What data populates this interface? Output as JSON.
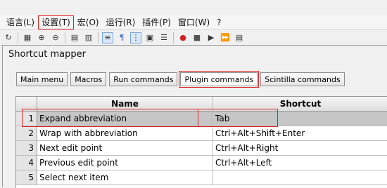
{
  "menubar": {
    "items": [
      {
        "label": "语言(L)"
      },
      {
        "label": "设置(T)"
      },
      {
        "label": "宏(O)"
      },
      {
        "label": "运行(R)"
      },
      {
        "label": "插件(P)"
      },
      {
        "label": "窗口(W)"
      },
      {
        "label": "?"
      }
    ]
  },
  "toolbar": {
    "icons": [
      "refresh-icon",
      "print-icon",
      "zoom-in-icon",
      "zoom-out-icon",
      "sync-v-icon",
      "sync-h-icon",
      "wrap-icon",
      "paragraph-icon",
      "indent-guide-icon",
      "doc-map-icon",
      "func-list-icon",
      "record-icon",
      "stop-icon",
      "play-icon",
      "play-multi-icon",
      "save-macro-icon"
    ]
  },
  "dialog": {
    "title": "Shortcut mapper",
    "tabs": [
      {
        "label": "Main menu"
      },
      {
        "label": "Macros"
      },
      {
        "label": "Run commands"
      },
      {
        "label": "Plugin commands"
      },
      {
        "label": "Scintilla commands"
      }
    ],
    "active_tab": "Plugin commands",
    "grid": {
      "headers": {
        "name": "Name",
        "shortcut": "Shortcut"
      },
      "rows": [
        {
          "num": "1",
          "name": "Expand abbreviation",
          "shortcut": "Tab"
        },
        {
          "num": "2",
          "name": "Wrap with abbreviation",
          "shortcut": "Ctrl+Alt+Shift+Enter"
        },
        {
          "num": "3",
          "name": "Next edit point",
          "shortcut": "Ctrl+Alt+Right"
        },
        {
          "num": "4",
          "name": "Previous edit point",
          "shortcut": "Ctrl+Alt+Left"
        },
        {
          "num": "5",
          "name": "Select next item",
          "shortcut": ""
        }
      ]
    }
  },
  "colors": {
    "highlight_outline": "#e02020",
    "selected_row": "#c6c6c6"
  }
}
